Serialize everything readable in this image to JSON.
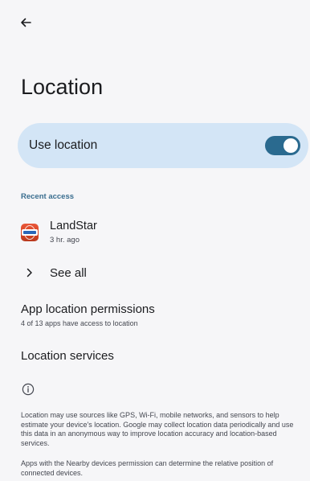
{
  "toolbar": {
    "back_icon": "arrow-left-icon"
  },
  "page": {
    "title": "Location"
  },
  "main_switch": {
    "label": "Use location",
    "checked": true,
    "accent_color": "#2a6a8f",
    "row_color": "#d3e5f6"
  },
  "recent_access": {
    "header": "Recent access",
    "apps": [
      {
        "name": "LandStar",
        "time": "3 hr. ago",
        "icon": "landstar-app-icon"
      }
    ],
    "see_all_label": "See all"
  },
  "permissions": {
    "title": "App location permissions",
    "summary": "4 of 13 apps have access to location"
  },
  "services": {
    "title": "Location services"
  },
  "footer": {
    "info_icon": "info-icon",
    "paragraphs": [
      "Location may use sources like GPS, Wi-Fi, mobile networks, and sensors to help estimate your device's location. Google may collect location data periodically and use this data in an anonymous way to improve location accuracy and location-based services.",
      "Apps with the Nearby devices permission can determine the relative position of connected devices."
    ]
  }
}
